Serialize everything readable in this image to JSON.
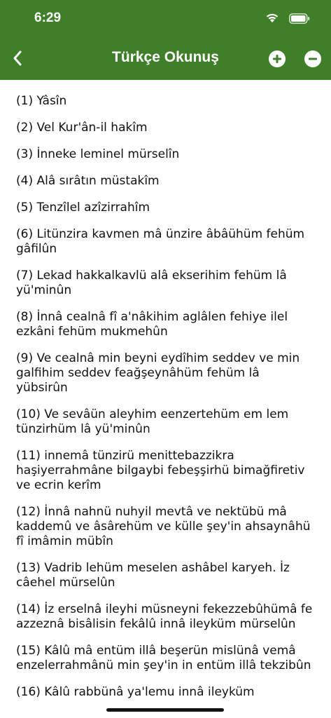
{
  "status_bar": {
    "time": "6:29"
  },
  "header": {
    "title": "Türkçe Okunuş",
    "back_icon": "chevron-left-icon",
    "zoom_in_icon": "plus-circle-icon",
    "zoom_out_icon": "minus-circle-icon"
  },
  "colors": {
    "header_bg": "#3f7f2a",
    "text": "#111111",
    "background": "#ffffff"
  },
  "verses": [
    "(1) Yâsîn",
    "(2) Vel Kur'ân-il hakîm",
    "(3) İnneke leminel mürselîn",
    "(4) Alâ sırâtın müstakîm",
    "(5) Tenzîlel azîzirrahîm",
    "(6) Litünzira kavmen mâ ünzire âbâühüm fehüm gâfilûn",
    "(7) Lekad hakkalkavlü alâ ekserihim fehüm lâ yü'minûn",
    "(8) İnnâ cealnâ fî a'nâkihim aglâlen fehiye ilel ezkâni fehüm mukmehûn",
    "(9) Ve cealnâ min beyni eydîhim seddev ve min galfihim seddev feağşeynâhüm fehüm lâ yübsirûn",
    "(10) Ve sevâün aleyhim eenzertehüm em lem tünzirhüm lâ yü'minûn",
    "(11) innemâ tünzirü menittebazzikra haşiyerrahmâne bilgaybi febeşşirhü bimağfiretiv ve ecrin kerîm",
    "(12) İnnâ nahnü nuhyil mevtâ ve nektübü mâ kaddemû ve âsârehüm ve külle şey'in ahsaynâhü fî imâmin mübîn",
    "(13) Vadrib lehüm meselen ashâbel karyeh. İz câehel mürselûn",
    "(14) İz erselnâ ileyhi müsneyni fekezzebûhümâ fe azzeznâ bisâlisin fekâlû innâ ileyküm mürselûn",
    "(15) Kâlû mâ entüm illâ beşerün mislünâ vemâ enzelerrahmânü min şey'in in entüm illâ tekzibûn",
    "(16) Kâlû rabbünâ ya'lemu innâ ileyküm"
  ]
}
